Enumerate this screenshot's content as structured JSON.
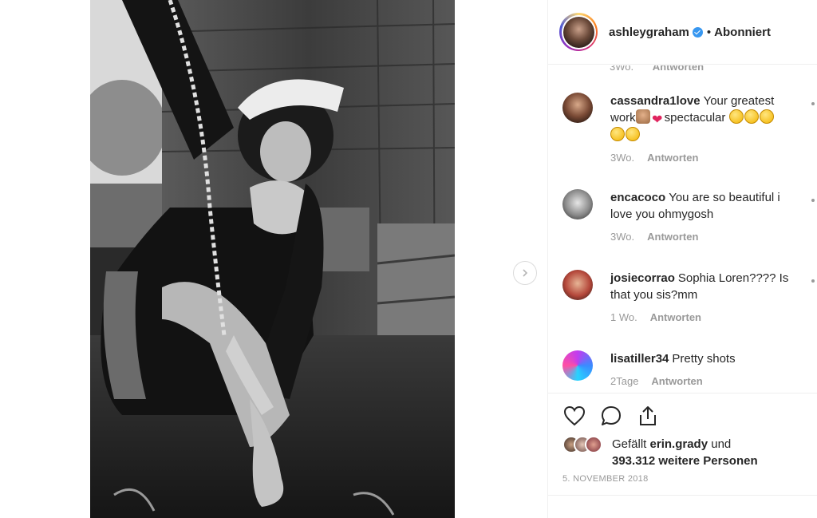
{
  "header": {
    "username": "ashleygraham",
    "separator": "•",
    "follow_status": "Abonniert"
  },
  "cut_comment_meta": {
    "time": "3Wo.",
    "reply": "Antworten"
  },
  "comments": [
    {
      "user": "cassandra1love",
      "text": "Your greatest work",
      "text2": "spectacular",
      "time": "3Wo.",
      "reply": "Antworten"
    },
    {
      "user": "encacoco",
      "text": "You are so beautiful i love you ohmygosh",
      "time": "3Wo.",
      "reply": "Antworten"
    },
    {
      "user": "josiecorrao",
      "text": "Sophia Loren???? Is that you sis?mm",
      "time": "1 Wo.",
      "reply": "Antworten"
    },
    {
      "user": "lisatiller34",
      "text": "Pretty shots",
      "time": "2Tage",
      "reply": "Antworten"
    }
  ],
  "likes": {
    "prefix": "Gefällt",
    "user": "erin.grady",
    "conjunction": "und",
    "count_text": "393.312 weitere Personen"
  },
  "date": "5. NOVEMBER 2018",
  "icons": [
    "heart-icon",
    "comment-icon",
    "share-icon",
    "verified-icon",
    "chevron-right-icon"
  ],
  "colors": {
    "verified": "#3897f0",
    "muted": "#999999",
    "text": "#262626",
    "border": "#efefef"
  }
}
